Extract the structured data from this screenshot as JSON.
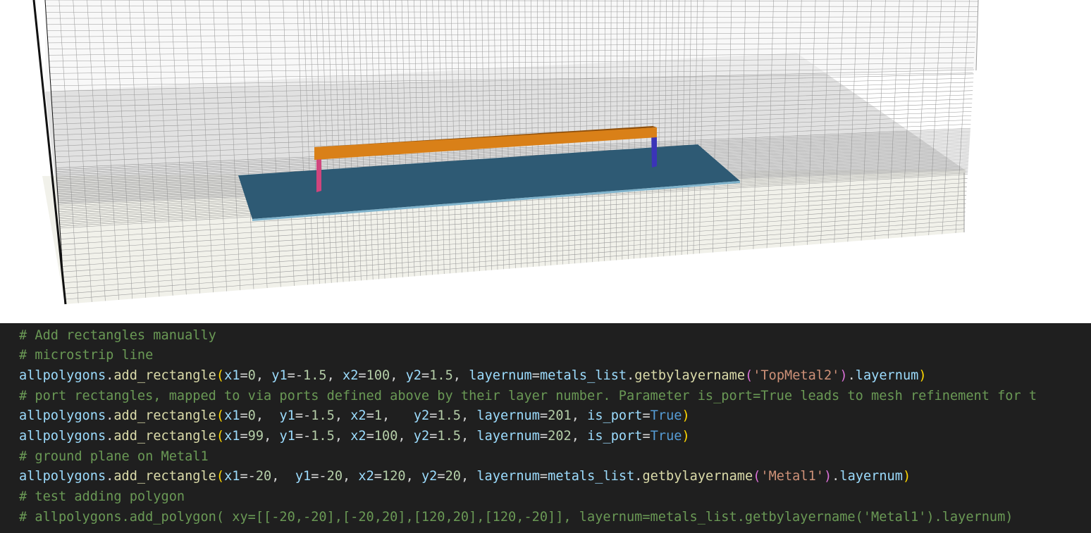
{
  "viewport": {
    "colors": {
      "background": "#ffffff",
      "mesh_line": "#9a9a9a",
      "mesh_dense": "#7c7c7c",
      "substrate_face": "#c9c9c9",
      "floor_face": "#efefe6",
      "ground_plane": "#2e5a74",
      "microstrip_top": "#d98018",
      "microstrip_side": "#8e4f0c",
      "port_left": "#d0457d",
      "port_right": "#3b34b8",
      "axis_edge": "#111111"
    }
  },
  "editor": {
    "lines": [
      [
        {
          "t": "# Add rectangles manually",
          "c": "comment"
        }
      ],
      [
        {
          "t": "# microstrip line",
          "c": "comment"
        }
      ],
      [
        {
          "t": "allpolygons",
          "c": "var"
        },
        {
          "t": ".",
          "c": "plain"
        },
        {
          "t": "add_rectangle",
          "c": "fn"
        },
        {
          "t": "(",
          "c": "p1"
        },
        {
          "t": "x1",
          "c": "var"
        },
        {
          "t": "=",
          "c": "plain"
        },
        {
          "t": "0",
          "c": "num"
        },
        {
          "t": ", ",
          "c": "plain"
        },
        {
          "t": "y1",
          "c": "var"
        },
        {
          "t": "=-",
          "c": "plain"
        },
        {
          "t": "1.5",
          "c": "num"
        },
        {
          "t": ", ",
          "c": "plain"
        },
        {
          "t": "x2",
          "c": "var"
        },
        {
          "t": "=",
          "c": "plain"
        },
        {
          "t": "100",
          "c": "num"
        },
        {
          "t": ", ",
          "c": "plain"
        },
        {
          "t": "y2",
          "c": "var"
        },
        {
          "t": "=",
          "c": "plain"
        },
        {
          "t": "1.5",
          "c": "num"
        },
        {
          "t": ", ",
          "c": "plain"
        },
        {
          "t": "layernum",
          "c": "var"
        },
        {
          "t": "=",
          "c": "plain"
        },
        {
          "t": "metals_list",
          "c": "var"
        },
        {
          "t": ".",
          "c": "plain"
        },
        {
          "t": "getbylayername",
          "c": "fn"
        },
        {
          "t": "(",
          "c": "p2"
        },
        {
          "t": "'TopMetal2'",
          "c": "str"
        },
        {
          "t": ")",
          "c": "p2"
        },
        {
          "t": ".",
          "c": "plain"
        },
        {
          "t": "layernum",
          "c": "var"
        },
        {
          "t": ")",
          "c": "p1"
        }
      ],
      [
        {
          "t": "# port rectangles, mapped to via ports defined above by their layer number. Parameter is_port=True leads to mesh refinement for t",
          "c": "comment"
        }
      ],
      [
        {
          "t": "allpolygons",
          "c": "var"
        },
        {
          "t": ".",
          "c": "plain"
        },
        {
          "t": "add_rectangle",
          "c": "fn"
        },
        {
          "t": "(",
          "c": "p1"
        },
        {
          "t": "x1",
          "c": "var"
        },
        {
          "t": "=",
          "c": "plain"
        },
        {
          "t": "0",
          "c": "num"
        },
        {
          "t": ",  ",
          "c": "plain"
        },
        {
          "t": "y1",
          "c": "var"
        },
        {
          "t": "=-",
          "c": "plain"
        },
        {
          "t": "1.5",
          "c": "num"
        },
        {
          "t": ", ",
          "c": "plain"
        },
        {
          "t": "x2",
          "c": "var"
        },
        {
          "t": "=",
          "c": "plain"
        },
        {
          "t": "1",
          "c": "num"
        },
        {
          "t": ",   ",
          "c": "plain"
        },
        {
          "t": "y2",
          "c": "var"
        },
        {
          "t": "=",
          "c": "plain"
        },
        {
          "t": "1.5",
          "c": "num"
        },
        {
          "t": ", ",
          "c": "plain"
        },
        {
          "t": "layernum",
          "c": "var"
        },
        {
          "t": "=",
          "c": "plain"
        },
        {
          "t": "201",
          "c": "num"
        },
        {
          "t": ", ",
          "c": "plain"
        },
        {
          "t": "is_port",
          "c": "var"
        },
        {
          "t": "=",
          "c": "plain"
        },
        {
          "t": "True",
          "c": "kw"
        },
        {
          "t": ")",
          "c": "p1"
        }
      ],
      [
        {
          "t": "allpolygons",
          "c": "var"
        },
        {
          "t": ".",
          "c": "plain"
        },
        {
          "t": "add_rectangle",
          "c": "fn"
        },
        {
          "t": "(",
          "c": "p1"
        },
        {
          "t": "x1",
          "c": "var"
        },
        {
          "t": "=",
          "c": "plain"
        },
        {
          "t": "99",
          "c": "num"
        },
        {
          "t": ", ",
          "c": "plain"
        },
        {
          "t": "y1",
          "c": "var"
        },
        {
          "t": "=-",
          "c": "plain"
        },
        {
          "t": "1.5",
          "c": "num"
        },
        {
          "t": ", ",
          "c": "plain"
        },
        {
          "t": "x2",
          "c": "var"
        },
        {
          "t": "=",
          "c": "plain"
        },
        {
          "t": "100",
          "c": "num"
        },
        {
          "t": ", ",
          "c": "plain"
        },
        {
          "t": "y2",
          "c": "var"
        },
        {
          "t": "=",
          "c": "plain"
        },
        {
          "t": "1.5",
          "c": "num"
        },
        {
          "t": ", ",
          "c": "plain"
        },
        {
          "t": "layernum",
          "c": "var"
        },
        {
          "t": "=",
          "c": "plain"
        },
        {
          "t": "202",
          "c": "num"
        },
        {
          "t": ", ",
          "c": "plain"
        },
        {
          "t": "is_port",
          "c": "var"
        },
        {
          "t": "=",
          "c": "plain"
        },
        {
          "t": "True",
          "c": "kw"
        },
        {
          "t": ")",
          "c": "p1"
        }
      ],
      [
        {
          "t": "# ground plane on Metal1",
          "c": "comment"
        }
      ],
      [
        {
          "t": "allpolygons",
          "c": "var"
        },
        {
          "t": ".",
          "c": "plain"
        },
        {
          "t": "add_rectangle",
          "c": "fn"
        },
        {
          "t": "(",
          "c": "p1"
        },
        {
          "t": "x1",
          "c": "var"
        },
        {
          "t": "=-",
          "c": "plain"
        },
        {
          "t": "20",
          "c": "num"
        },
        {
          "t": ",  ",
          "c": "plain"
        },
        {
          "t": "y1",
          "c": "var"
        },
        {
          "t": "=-",
          "c": "plain"
        },
        {
          "t": "20",
          "c": "num"
        },
        {
          "t": ", ",
          "c": "plain"
        },
        {
          "t": "x2",
          "c": "var"
        },
        {
          "t": "=",
          "c": "plain"
        },
        {
          "t": "120",
          "c": "num"
        },
        {
          "t": ", ",
          "c": "plain"
        },
        {
          "t": "y2",
          "c": "var"
        },
        {
          "t": "=",
          "c": "plain"
        },
        {
          "t": "20",
          "c": "num"
        },
        {
          "t": ", ",
          "c": "plain"
        },
        {
          "t": "layernum",
          "c": "var"
        },
        {
          "t": "=",
          "c": "plain"
        },
        {
          "t": "metals_list",
          "c": "var"
        },
        {
          "t": ".",
          "c": "plain"
        },
        {
          "t": "getbylayername",
          "c": "fn"
        },
        {
          "t": "(",
          "c": "p2"
        },
        {
          "t": "'Metal1'",
          "c": "str"
        },
        {
          "t": ")",
          "c": "p2"
        },
        {
          "t": ".",
          "c": "plain"
        },
        {
          "t": "layernum",
          "c": "var"
        },
        {
          "t": ")",
          "c": "p1"
        }
      ],
      [
        {
          "t": "# test adding polygon",
          "c": "comment"
        }
      ],
      [
        {
          "t": "# allpolygons.add_polygon( xy=[[-20,-20],[-20,20],[120,20],[120,-20]], layernum=metals_list.getbylayername('Metal1').layernum)",
          "c": "comment"
        }
      ]
    ]
  }
}
